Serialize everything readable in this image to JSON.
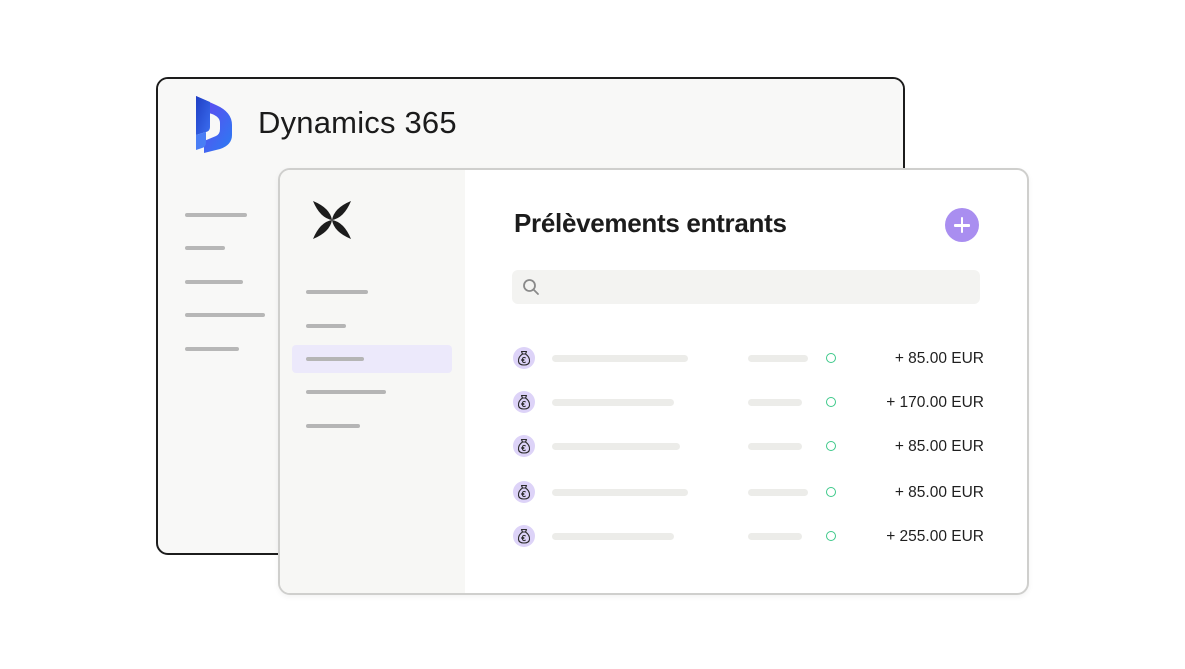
{
  "back_window": {
    "title": "Dynamics 365",
    "logo_icon": "dynamics-365-logo-icon"
  },
  "front_window": {
    "logo_icon": "four-petal-brand-logo-icon",
    "page_title": "Prélèvements entrants",
    "add_icon": "plus-icon",
    "search": {
      "icon": "search-icon",
      "value": "",
      "placeholder": ""
    },
    "status_color": "#3ec98a",
    "accent_color": "#a98ef0",
    "rows": [
      {
        "icon": "money-bag-euro-icon",
        "amount": "+ 85.00 EUR"
      },
      {
        "icon": "money-bag-euro-icon",
        "amount": "+ 170.00 EUR"
      },
      {
        "icon": "money-bag-euro-icon",
        "amount": "+ 85.00 EUR"
      },
      {
        "icon": "money-bag-euro-icon",
        "amount": "+ 85.00 EUR"
      },
      {
        "icon": "money-bag-euro-icon",
        "amount": "+ 255.00 EUR"
      }
    ]
  }
}
